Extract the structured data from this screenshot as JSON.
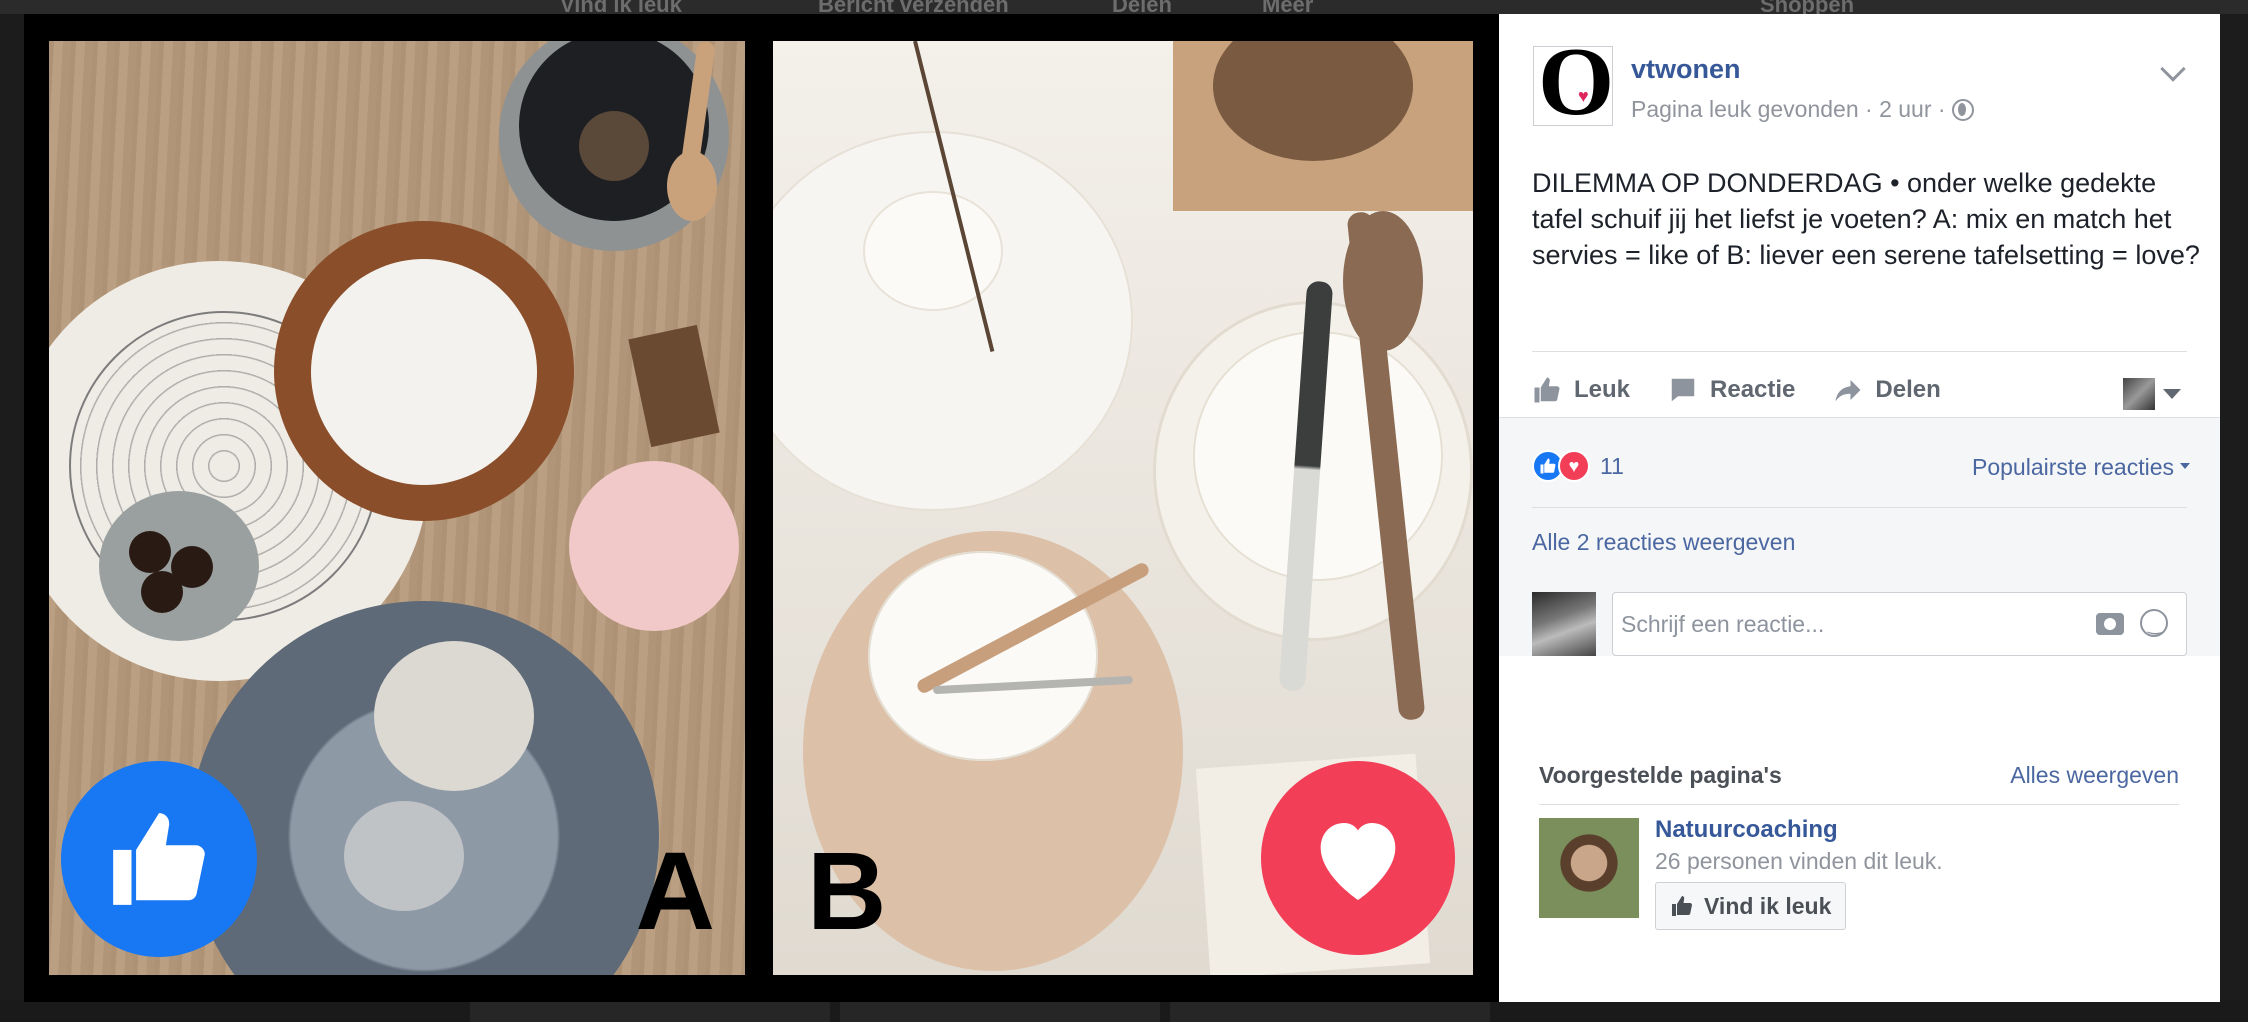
{
  "background": {
    "ghost_labels": [
      "Vind ik leuk",
      "Bericht verzenden",
      "Delen",
      "Meer",
      "Shoppen"
    ]
  },
  "photo": {
    "letter_a": "A",
    "letter_b": "B",
    "badge_a": "like-icon",
    "badge_b": "heart-icon",
    "colors": {
      "like_blue": "#1877f2",
      "love_red": "#f33e58"
    }
  },
  "post": {
    "page_name": "vtwonen",
    "meta_text": "Pagina leuk gevonden · 2 uur ·",
    "body": "DILEMMA OP DONDERDAG • onder welke gedekte tafel schuif jij het liefst je voeten? A: mix en match het servies = like of B: liever een serene tafelsetting = love?",
    "actions": {
      "like": "Leuk",
      "comment": "Reactie",
      "share": "Delen"
    }
  },
  "feedback": {
    "reaction_count": "11",
    "sort_label": "Populairste reacties",
    "view_comments": "Alle 2 reacties weergeven",
    "comment_placeholder": "Schrijf een reactie..."
  },
  "suggestions": {
    "title": "Voorgestelde pagina's",
    "see_all": "Alles weergeven",
    "items": [
      {
        "name": "Natuurcoaching",
        "meta": "26 personen vinden dit leuk.",
        "button": "Vind ik leuk"
      }
    ]
  }
}
